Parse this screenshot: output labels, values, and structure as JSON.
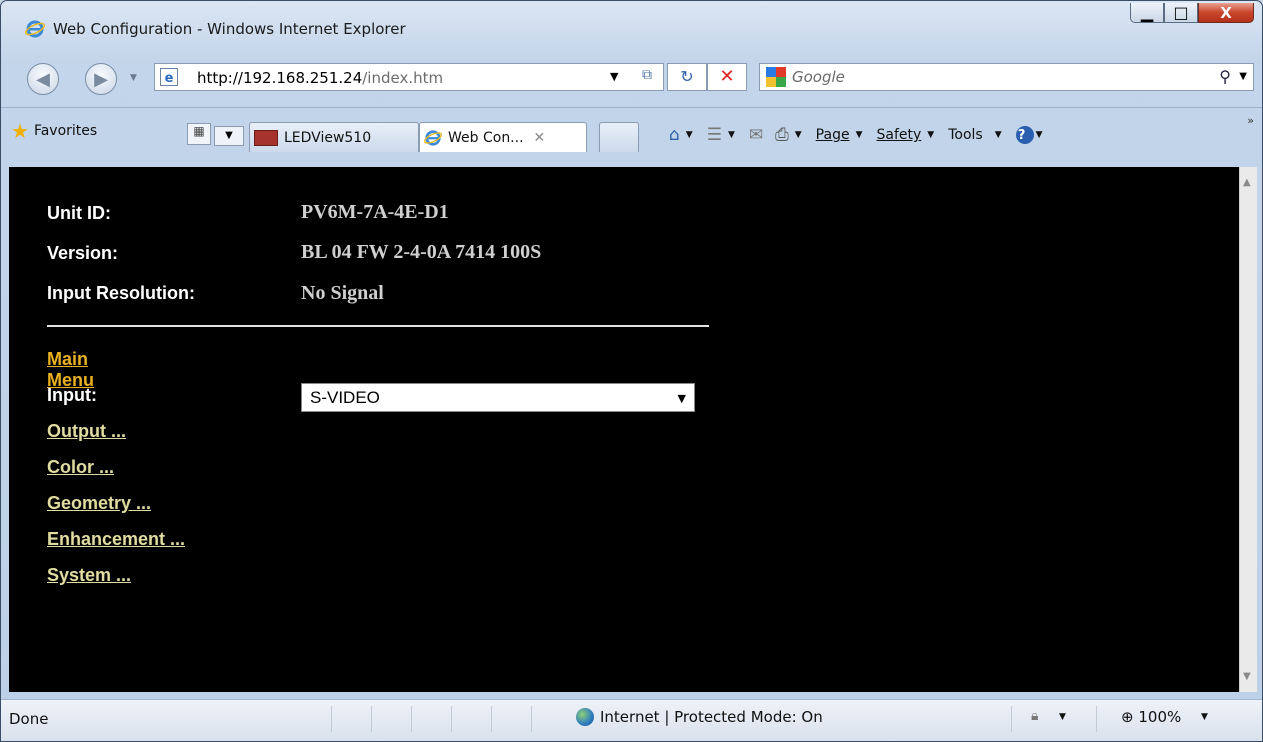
{
  "window": {
    "title": "Web Configuration - Windows Internet Explorer",
    "min_glyph": "▁",
    "max_glyph": "□",
    "close_glyph": "X"
  },
  "nav": {
    "back_glyph": "◀",
    "forward_glyph": "▶",
    "dropdown_glyph": "▼",
    "address_host": "http://192.168.251.24",
    "address_path": "/index.htm",
    "refresh_glyph": "↻",
    "stop_glyph": "✕",
    "search_placeholder": "Google",
    "search_icon": "⚲"
  },
  "toolbar": {
    "favorites_label": "Favorites",
    "favorites_icon": "★",
    "quicktabs_glyph": "▦",
    "tabs": [
      {
        "label": "LEDView510"
      },
      {
        "label": "Web Con...",
        "close": "✕"
      }
    ],
    "home_icon": "⌂",
    "feeds_icon": "☰",
    "mail_icon": "✉",
    "print_icon": "⎙",
    "page_label": "Page",
    "safety_label": "Safety",
    "tools_label": "Tools",
    "help_icon": "?",
    "chevron": "»"
  },
  "page": {
    "unit_id_label": "Unit ID:",
    "unit_id_value": "PV6M-7A-4E-D1",
    "version_label": "Version:",
    "version_value": "BL 04 FW 2-4-0A 7414 100S",
    "resolution_label": "Input Resolution:",
    "resolution_value": "No Signal",
    "main_menu": "Main Menu",
    "input_label": "Input:",
    "input_value": "S-VIDEO",
    "links": [
      "Output ...",
      "Color ...",
      "Geometry ...",
      "Enhancement ...",
      "System ..."
    ]
  },
  "statusbar": {
    "status": "Done",
    "zone": "Internet | Protected Mode: On",
    "zoom": "100%"
  },
  "colors": {
    "main_menu": "#e7b020",
    "link": "#e0dca0",
    "value_gray": "#cfcfcf",
    "page_bg": "#000000"
  }
}
